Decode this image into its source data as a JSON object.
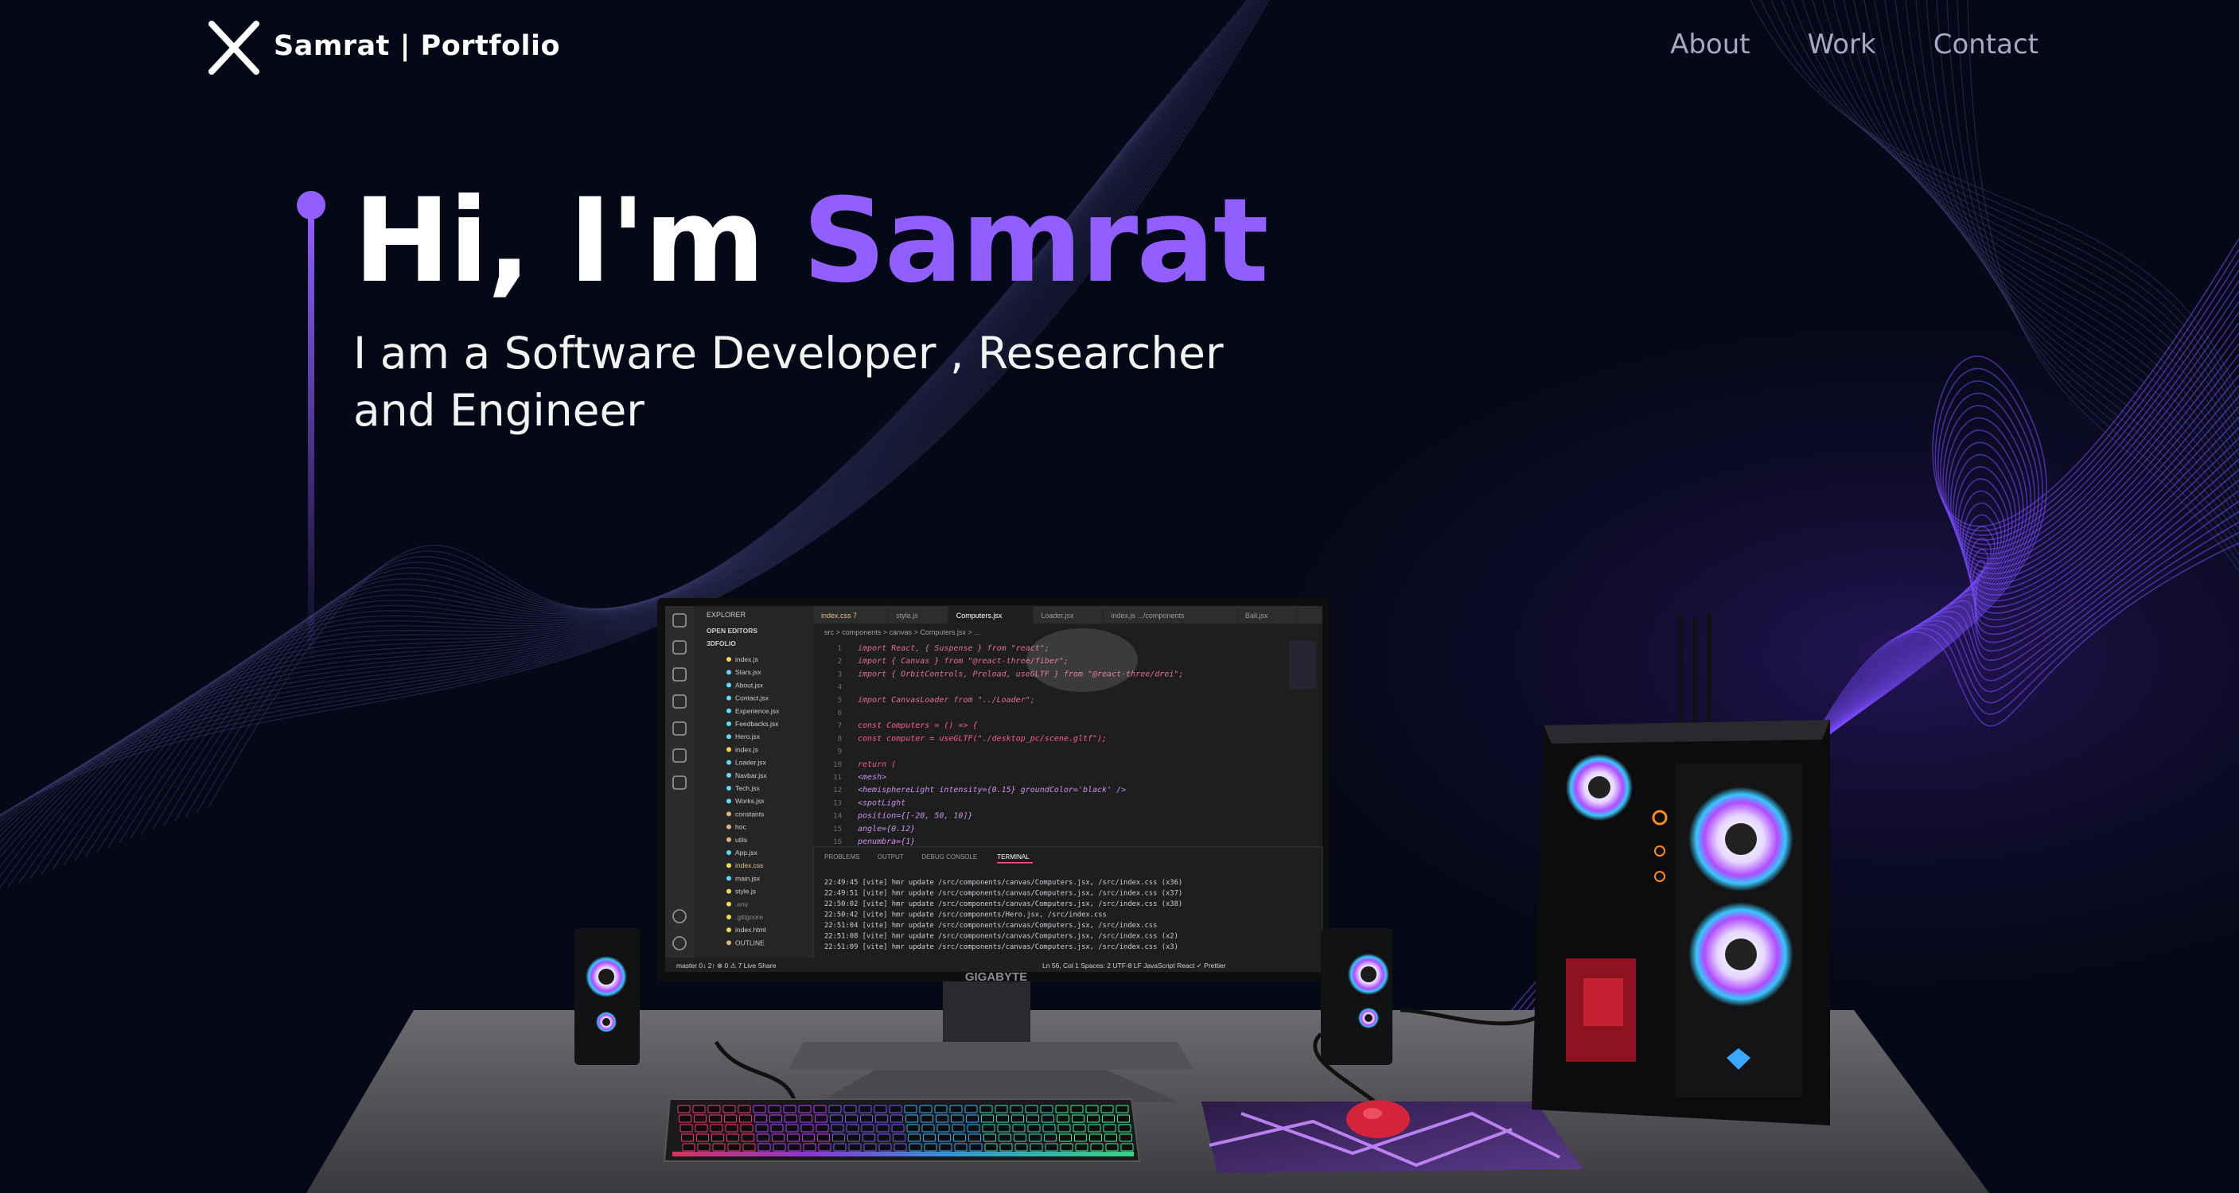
{
  "nav": {
    "brand": "Samrat | Portfolio",
    "links": [
      "About",
      "Work",
      "Contact"
    ]
  },
  "hero": {
    "greeting": "Hi, I'm ",
    "name": "Samrat",
    "subtitle": "I am a Software Developer , Researcher and Engineer"
  },
  "monitor": {
    "brand_label": "GIGABYTE",
    "editor": {
      "explorer_header": "EXPLORER",
      "open_editors": "OPEN EDITORS",
      "project": "3DFOLIO",
      "files": [
        "index.js",
        "Stars.jsx",
        "About.jsx",
        "Contact.jsx",
        "Experience.jsx",
        "Feedbacks.jsx",
        "Hero.jsx",
        "index.js",
        "Loader.jsx",
        "Navbar.jsx",
        "Tech.jsx",
        "Works.jsx",
        "constants",
        "hoc",
        "utils",
        "App.jsx",
        "index.css",
        "main.jsx",
        "style.js",
        ".env",
        ".gitignore",
        "index.html",
        "OUTLINE"
      ],
      "tabs": [
        "index.css 7",
        "style.js",
        "Computers.jsx",
        "Loader.jsx",
        "index.js .../components",
        "Ball.jsx"
      ],
      "active_tab": "Computers.jsx",
      "breadcrumb": "src > components > canvas > Computers.jsx > ...",
      "code_lines": [
        "import React, { Suspense } from \"react\";",
        "import { Canvas } from \"@react-three/fiber\";",
        "import { OrbitControls, Preload, useGLTF } from \"@react-three/drei\";",
        "",
        "import CanvasLoader from \"../Loader\";",
        "",
        "const Computers = () => {",
        "  const computer = useGLTF(\"./desktop_pc/scene.gltf\");",
        "",
        "  return (",
        "    <mesh>",
        "      <hemisphereLight intensity={0.15} groundColor='black' />",
        "      <spotLight",
        "        position={[-20, 50, 10]}",
        "        angle={0.12}",
        "        penumbra={1}"
      ],
      "panel_tabs": [
        "PROBLEMS",
        "OUTPUT",
        "DEBUG CONSOLE",
        "TERMINAL"
      ],
      "terminal_lines": [
        "22:49:45 [vite] hmr update /src/components/canvas/Computers.jsx, /src/index.css (x36)",
        "22:49:51 [vite] hmr update /src/components/canvas/Computers.jsx, /src/index.css (x37)",
        "22:50:02 [vite] hmr update /src/components/canvas/Computers.jsx, /src/index.css (x38)",
        "22:50:42 [vite] hmr update /src/components/Hero.jsx, /src/index.css",
        "22:51:04 [vite] hmr update /src/components/canvas/Computers.jsx, /src/index.css",
        "22:51:08 [vite] hmr update /src/components/canvas/Computers.jsx, /src/index.css (x2)",
        "22:51:09 [vite] hmr update /src/components/canvas/Computers.jsx, /src/index.css (x3)"
      ],
      "status_left": "master  0↓ 2↑  ⊗ 0 ⚠ 7  Live Share",
      "status_right": "Ln 56, Col 1  Spaces: 2  UTF-8  LF  JavaScript React  ✓ Prettier"
    }
  },
  "colors": {
    "background": "#050816",
    "accent": "#915EFF",
    "nav_link": "#aaa6c3"
  }
}
